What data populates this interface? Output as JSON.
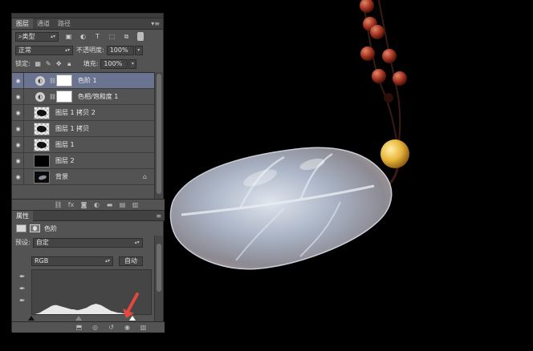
{
  "layers_panel": {
    "tabs": [
      "图层",
      "通道",
      "路径"
    ],
    "menu_icon": "panel-menu-icon",
    "filter": {
      "kind": "类型"
    },
    "blend_mode": "正常",
    "opacity_label": "不透明度:",
    "opacity_value": "100%",
    "lock_label": "锁定:",
    "fill_label": "填充:",
    "fill_value": "100%",
    "layers": [
      {
        "name": "色阶 1",
        "type": "adjustment",
        "selected": true
      },
      {
        "name": "色相/饱和度 1",
        "type": "adjustment",
        "selected": false
      },
      {
        "name": "图层 1 拷贝 2",
        "type": "pixel-checker",
        "selected": false
      },
      {
        "name": "图层 1 拷贝",
        "type": "pixel-checker",
        "selected": false
      },
      {
        "name": "图层 1",
        "type": "pixel-checker",
        "selected": false
      },
      {
        "name": "图层 2",
        "type": "pixel-black",
        "selected": false
      },
      {
        "name": "背景",
        "type": "background",
        "selected": false,
        "locked": true
      }
    ]
  },
  "properties_panel": {
    "tab": "属性",
    "title": "色阶",
    "preset_label": "预设:",
    "preset_value": "自定",
    "channel_value": "RGB",
    "auto_button": "自动",
    "histogram_levels": [
      0,
      1,
      2,
      3,
      5,
      7,
      9,
      11,
      13,
      14,
      14,
      13,
      12,
      11,
      10,
      9,
      8,
      8,
      7,
      7,
      8,
      9,
      10,
      12,
      14,
      15,
      16,
      15,
      14,
      12,
      10,
      8,
      6,
      5,
      4,
      3,
      3,
      2,
      2,
      2,
      1,
      1,
      1,
      1,
      1,
      1,
      0,
      0,
      0,
      0
    ],
    "input_levels": {
      "black": 0,
      "mid": 0.39,
      "white": 0.84
    },
    "colors": {
      "selection": "#6a7390",
      "arrow": "#e2483e"
    }
  },
  "chart_data": {
    "type": "area",
    "values": [
      0,
      1,
      2,
      3,
      5,
      7,
      9,
      11,
      13,
      14,
      14,
      13,
      12,
      11,
      10,
      9,
      8,
      8,
      7,
      7,
      8,
      9,
      10,
      12,
      14,
      15,
      16,
      15,
      14,
      12,
      10,
      8,
      6,
      5,
      4,
      3,
      3,
      2,
      2,
      2,
      1,
      1,
      1,
      1,
      1,
      1,
      0,
      0,
      0,
      0
    ]
  }
}
